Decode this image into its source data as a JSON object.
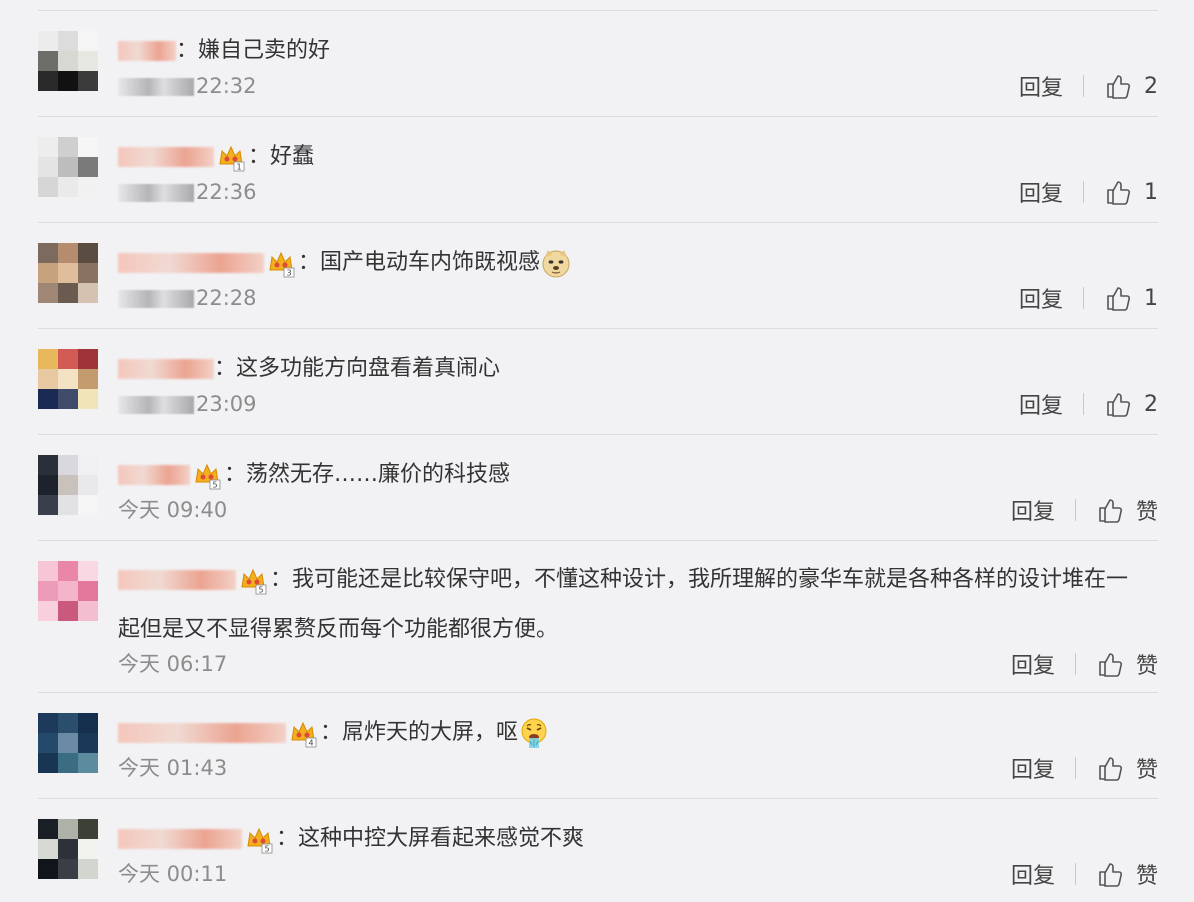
{
  "comments": [
    {
      "text": "嫌自己卖的好",
      "time": "22:32",
      "reply_label": "回复",
      "like_count": "2",
      "has_crown": false,
      "crown_level": "",
      "emoji": ""
    },
    {
      "text": "好蠢",
      "time": "22:36",
      "reply_label": "回复",
      "like_count": "1",
      "has_crown": true,
      "crown_level": "1",
      "emoji": ""
    },
    {
      "text": "国产电动车内饰既视感",
      "time": "22:28",
      "reply_label": "回复",
      "like_count": "1",
      "has_crown": true,
      "crown_level": "3",
      "emoji": "doge-emoji"
    },
    {
      "text": "这多功能方向盘看着真闹心",
      "time": "23:09",
      "reply_label": "回复",
      "like_count": "2",
      "has_crown": false,
      "crown_level": "",
      "emoji": ""
    },
    {
      "text": "荡然无存……廉价的科技感",
      "time": "今天 09:40",
      "reply_label": "回复",
      "like_count": "赞",
      "has_crown": true,
      "crown_level": "5",
      "emoji": ""
    },
    {
      "text": "我可能还是比较保守吧，不懂这种设计，我所理解的豪华车就是各种各样的设计堆在一起但是又不显得累赘反而每个功能都很方便。",
      "time": "今天 06:17",
      "reply_label": "回复",
      "like_count": "赞",
      "has_crown": true,
      "crown_level": "5",
      "emoji": ""
    },
    {
      "text": "屌炸天的大屏，呕",
      "time": "今天 01:43",
      "reply_label": "回复",
      "like_count": "赞",
      "has_crown": true,
      "crown_level": "4",
      "emoji": "vomit-emoji"
    },
    {
      "text": "这种中控大屏看起来感觉不爽",
      "time": "今天 00:11",
      "reply_label": "回复",
      "like_count": "赞",
      "has_crown": true,
      "crown_level": "5",
      "emoji": ""
    }
  ],
  "colors": {
    "background": "#f2f2f5",
    "username": "#eb7350",
    "time": "#8c8c8c",
    "crown": "#f2b01e",
    "divider": "#dcdcdf"
  }
}
